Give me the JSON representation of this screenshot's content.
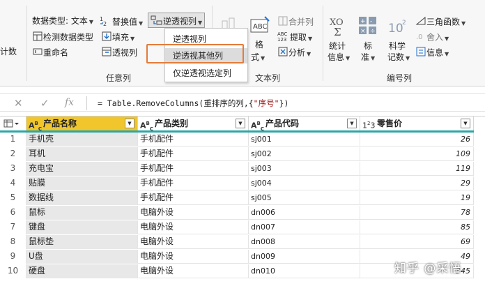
{
  "ribbon": {
    "left_clip": "计数",
    "data_type": "数据类型: 文本",
    "replace_values": "替换值",
    "unpivot_button": "逆透视列",
    "detect_type": "检测数据类型",
    "fill": "填充",
    "rename": "重命名",
    "pivot": "透视列",
    "group_any_col": "任意列",
    "format": "格",
    "format2": "式",
    "merge_cols": "合并列",
    "extract": "提取",
    "parse": "分析",
    "group_text_col": "文本列",
    "stats": "统计",
    "stats2": "信息",
    "standard": "标",
    "standard2": "准",
    "scientific": "科学",
    "scientific2": "记数",
    "trig": "三角函数",
    "rounding": "舍入",
    "information": "信息",
    "group_number_col": "编号列"
  },
  "menu": {
    "items": [
      "逆透视列",
      "逆透视其他列",
      "仅逆透视选定列"
    ],
    "selected_index": 1
  },
  "formula_bar": {
    "fx": "fx",
    "formula_prefix": "= Table.RemoveColumns(重排序的列,{",
    "formula_string": "\"序号\"",
    "formula_suffix": "})"
  },
  "columns": [
    {
      "type": "ABC",
      "name": "产品名称"
    },
    {
      "type": "ABC",
      "name": "产品类别"
    },
    {
      "type": "ABC",
      "name": "产品代码"
    },
    {
      "type": "123",
      "name": "零售价"
    }
  ],
  "rows": [
    {
      "n": "1",
      "name": "手机壳",
      "cat": "手机配件",
      "code": "sj001",
      "price": "26"
    },
    {
      "n": "2",
      "name": "耳机",
      "cat": "手机配件",
      "code": "sj002",
      "price": "109"
    },
    {
      "n": "3",
      "name": "充电宝",
      "cat": "手机配件",
      "code": "sj003",
      "price": "119"
    },
    {
      "n": "4",
      "name": "贴膜",
      "cat": "手机配件",
      "code": "sj004",
      "price": "29"
    },
    {
      "n": "5",
      "name": "数据线",
      "cat": "手机配件",
      "code": "sj005",
      "price": "19"
    },
    {
      "n": "6",
      "name": "鼠标",
      "cat": "电脑外设",
      "code": "dn006",
      "price": "78"
    },
    {
      "n": "7",
      "name": "键盘",
      "cat": "电脑外设",
      "code": "dn007",
      "price": "85"
    },
    {
      "n": "8",
      "name": "鼠标垫",
      "cat": "电脑外设",
      "code": "dn008",
      "price": "69"
    },
    {
      "n": "9",
      "name": "U盘",
      "cat": "电脑外设",
      "code": "dn009",
      "price": "49"
    },
    {
      "n": "10",
      "name": "硬盘",
      "cat": "电脑外设",
      "code": "dn010",
      "price": "345"
    }
  ],
  "watermark": "知乎 @采悟",
  "colors": {
    "active_header": "#f0c62c",
    "highlight_box": "#e57b3a",
    "quality_bar": "#2aa6a6"
  }
}
